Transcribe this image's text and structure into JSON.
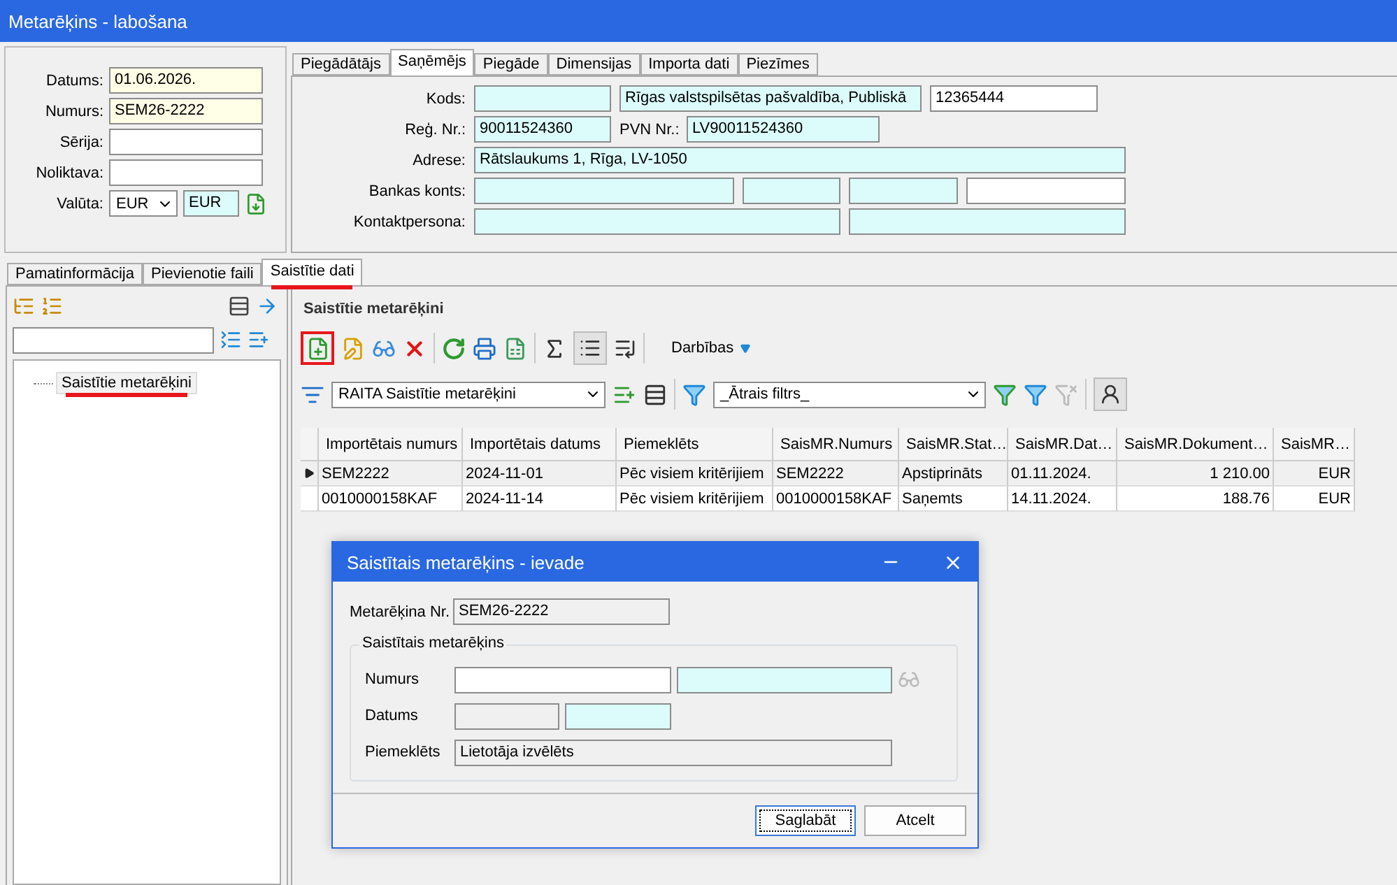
{
  "window": {
    "title": "Metarēķins - labošana"
  },
  "header_fields": [
    {
      "label": "Datums:",
      "kind": "required",
      "value": "01.06.2026."
    },
    {
      "label": "Numurs:",
      "kind": "required",
      "value": "SEM26-2222"
    },
    {
      "label": "Sērija:",
      "kind": "editable"
    },
    {
      "label": "Noliktava:",
      "kind": "editable"
    },
    {
      "label": "Valūta:",
      "kind": "currency",
      "value": "EUR",
      "code": "EUR"
    }
  ],
  "party_tabs": [
    {
      "label": "Piegādātājs",
      "selected": false
    },
    {
      "label": "Saņēmējs",
      "selected": true
    },
    {
      "label": "Piegāde",
      "selected": false
    },
    {
      "label": "Dimensijas",
      "selected": false
    },
    {
      "label": "Importa dati",
      "selected": false
    },
    {
      "label": "Piezīmes",
      "selected": false
    }
  ],
  "party_rows": [
    {
      "label": "Kods:",
      "fields": [
        {
          "kind": "readonly"
        },
        {
          "kind": "readonly",
          "value": "Rīgas valstspilsētas pašvaldība, Publiskā"
        },
        {
          "kind": "editable",
          "value": "12365444"
        }
      ]
    },
    {
      "label": "Reģ. Nr.:",
      "fields": [
        {
          "kind": "readonly",
          "value": "90011524360"
        },
        {
          "kind": "label",
          "value": "PVN Nr.:"
        },
        {
          "kind": "readonly",
          "value": "LV90011524360"
        }
      ]
    },
    {
      "label": "Adrese:",
      "fields": [
        {
          "kind": "readonly",
          "value": "Rātslaukums 1, Rīga, LV-1050"
        }
      ]
    },
    {
      "label": "Bankas konts:",
      "fields": [
        {
          "kind": "readonly"
        },
        {
          "kind": "readonly"
        },
        {
          "kind": "readonly"
        },
        {
          "kind": "editable"
        }
      ]
    },
    {
      "label": "Kontaktpersona:",
      "fields": [
        {
          "kind": "readonly"
        },
        {
          "kind": "readonly"
        }
      ]
    }
  ],
  "section_tabs": [
    {
      "label": "Pamatinformācija",
      "selected": false,
      "highlighted": false
    },
    {
      "label": "Pievienotie faili",
      "selected": false,
      "highlighted": false
    },
    {
      "label": "Saistītie dati",
      "selected": true,
      "highlighted": true
    }
  ],
  "tree": {
    "items": [
      {
        "label": "Saistītie metarēķini",
        "selected": true,
        "highlighted": true
      }
    ]
  },
  "panel": {
    "title": "Saistītie metarēķini",
    "add_button": {
      "highlighted": true
    },
    "grid_view_button": {
      "pressed": true
    },
    "actions_menu": "Darbības",
    "layout_select": "RAITA Saistītie metarēķini",
    "filter_select": "_Ātrais filtrs_",
    "clear_filter_button": {
      "disabled": true
    },
    "user_filter_button": {
      "pressed": true
    }
  },
  "grid": {
    "columns": [
      {
        "label": "Importētais numurs",
        "kind": "text"
      },
      {
        "label": "Importētais datums",
        "kind": "text"
      },
      {
        "label": "Piemeklēts",
        "kind": "text"
      },
      {
        "label": "SaisMR.Numurs",
        "kind": "text"
      },
      {
        "label": "SaisMR.Stat…",
        "kind": "text"
      },
      {
        "label": "SaisMR.Dat…",
        "kind": "text"
      },
      {
        "label": "SaisMR.Dokument…",
        "kind": "number"
      },
      {
        "label": "SaisMR…",
        "kind": "number"
      }
    ],
    "rows": [
      {
        "selected": true,
        "cells": [
          "SEM2222",
          "2024-11-01",
          "Pēc visiem kritērijiem",
          "SEM2222",
          "Apstiprināts",
          "01.11.2024.",
          "1 210.00",
          "EUR"
        ]
      },
      {
        "selected": false,
        "cells": [
          "0010000158KAF",
          "2024-11-14",
          "Pēc visiem kritērijiem",
          "0010000158KAF",
          "Saņemts",
          "14.11.2024.",
          "188.76",
          "EUR"
        ]
      }
    ]
  },
  "dialog": {
    "title": "Saistītais metarēķins - ievade",
    "invoice_label": "Metarēķina Nr.",
    "invoice_value": "SEM26-2222",
    "group_title": "Saistītais metarēķins",
    "rows": [
      {
        "label": "Numurs",
        "fields": [
          {
            "kind": "editable"
          },
          {
            "kind": "readonly"
          }
        ]
      },
      {
        "label": "Datums",
        "fields": [
          {
            "kind": "disabled"
          },
          {
            "kind": "readonly"
          }
        ]
      },
      {
        "label": "Piemeklēts",
        "fields": [
          {
            "kind": "disabled",
            "value": "Lietotāja izvēlēts"
          }
        ]
      }
    ],
    "buttons": [
      {
        "label": "Saglabāt",
        "focused": true
      },
      {
        "label": "Atcelt",
        "focused": false
      }
    ]
  }
}
